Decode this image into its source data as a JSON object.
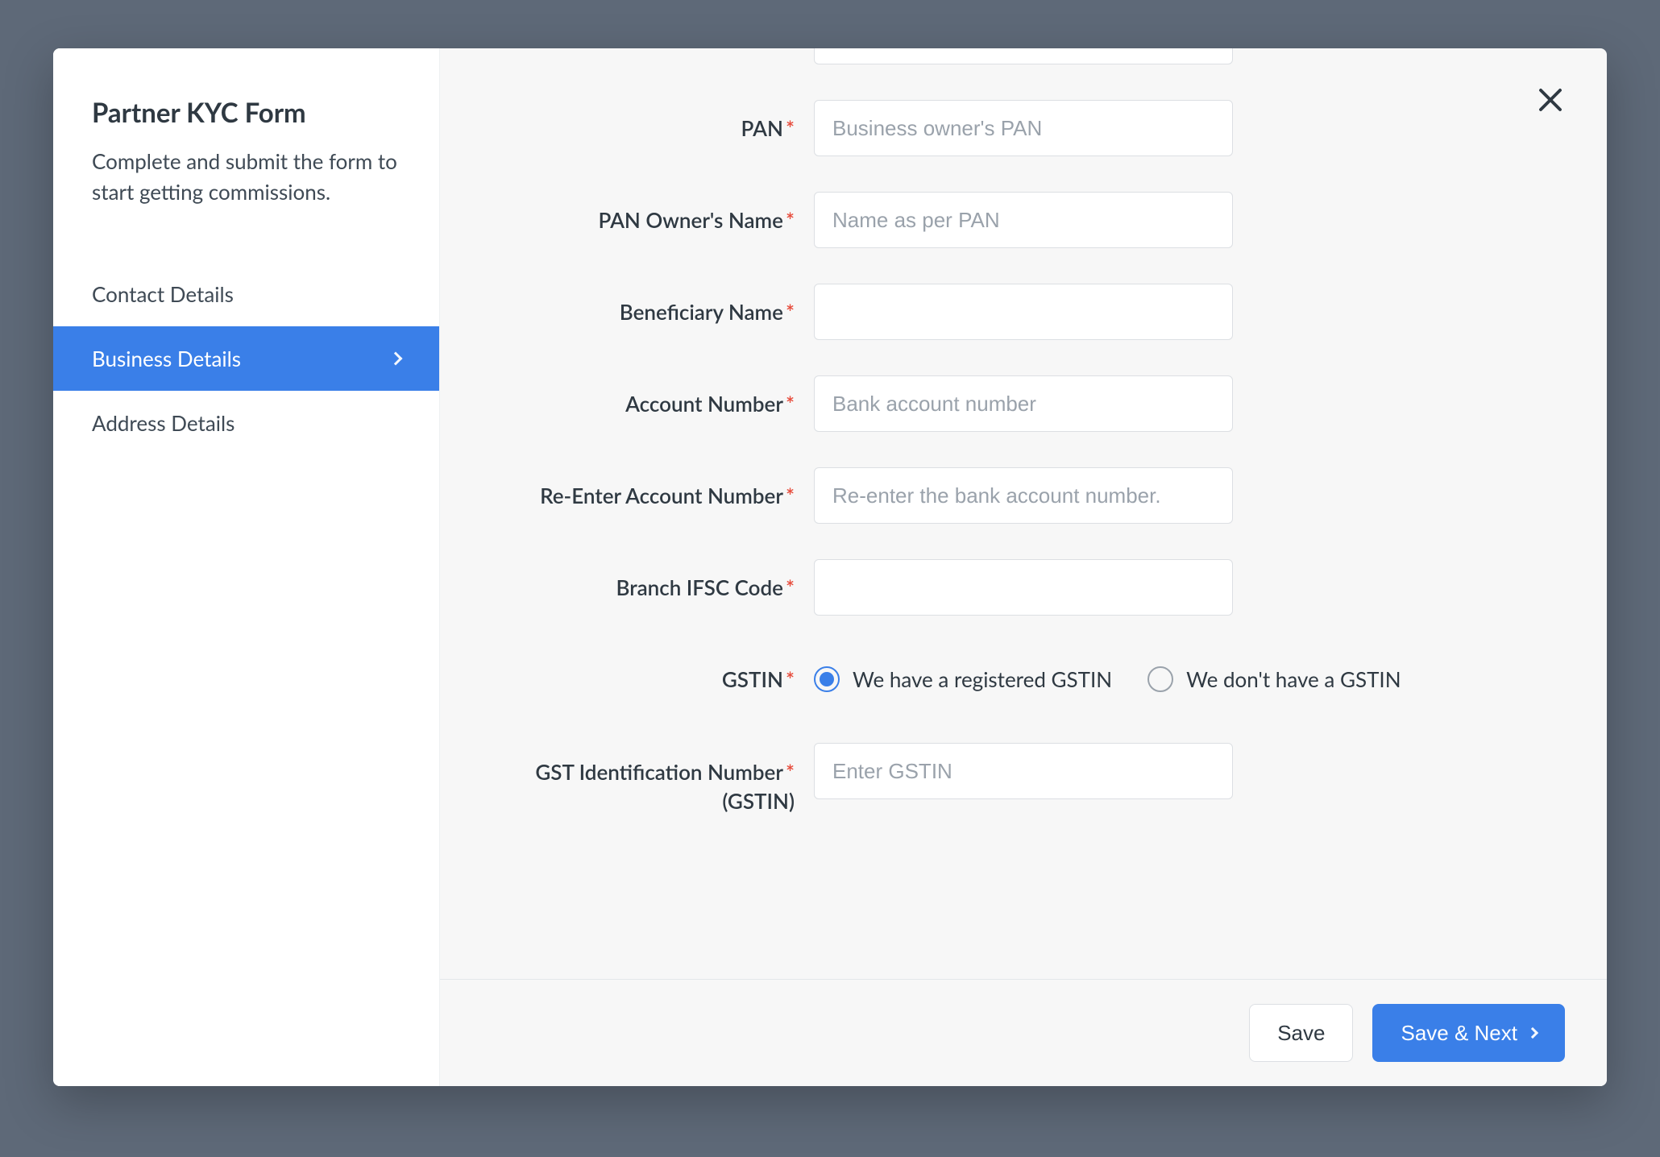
{
  "sidebar": {
    "title": "Partner KYC Form",
    "subtitle": "Complete and submit the form to start getting commissions.",
    "items": [
      {
        "label": "Contact Details",
        "active": false
      },
      {
        "label": "Business Details",
        "active": true
      },
      {
        "label": "Address Details",
        "active": false
      }
    ]
  },
  "form": {
    "fields": {
      "pan": {
        "label": "PAN",
        "placeholder": "Business owner's PAN",
        "required": true,
        "value": ""
      },
      "pan_owner_name": {
        "label": "PAN Owner's Name",
        "placeholder": "Name as per PAN",
        "required": true,
        "value": ""
      },
      "beneficiary": {
        "label": "Beneficiary Name",
        "placeholder": "",
        "required": true,
        "value": ""
      },
      "account": {
        "label": "Account Number",
        "placeholder": "Bank account number",
        "required": true,
        "value": ""
      },
      "account2": {
        "label": "Re-Enter Account Number",
        "placeholder": "Re-enter the bank account number.",
        "required": true,
        "value": ""
      },
      "ifsc": {
        "label": "Branch IFSC Code",
        "placeholder": "",
        "required": true,
        "value": ""
      },
      "gstin_radio": {
        "label": "GSTIN",
        "required": true,
        "options": [
          {
            "label": "We have a registered GSTIN",
            "selected": true
          },
          {
            "label": "We don't have a GSTIN",
            "selected": false
          }
        ]
      },
      "gstin_number": {
        "label_line1": "GST Identification Number",
        "label_line2": "(GSTIN)",
        "placeholder": "Enter GSTIN",
        "required": true,
        "value": ""
      }
    }
  },
  "footer": {
    "save": "Save",
    "save_next": "Save & Next"
  },
  "required_marker": "*"
}
